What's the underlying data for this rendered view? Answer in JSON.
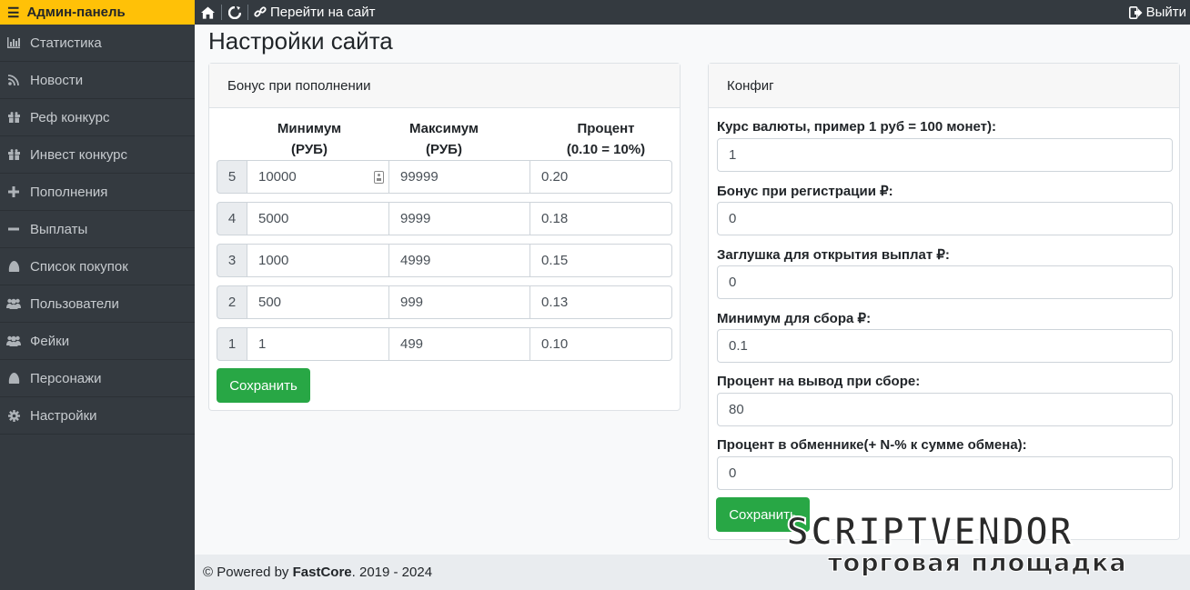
{
  "sidebar": {
    "title": "Админ-панель",
    "items": [
      {
        "label": "Статистика",
        "icon": "bar-chart-icon"
      },
      {
        "label": "Новости",
        "icon": "rss-icon"
      },
      {
        "label": "Реф конкурс",
        "icon": "gift-icon"
      },
      {
        "label": "Инвест конкурс",
        "icon": "gift-icon"
      },
      {
        "label": "Пополнения",
        "icon": "plus-icon"
      },
      {
        "label": "Выплаты",
        "icon": "minus-icon"
      },
      {
        "label": "Список покупок",
        "icon": "egg-icon"
      },
      {
        "label": "Пользователи",
        "icon": "users-icon"
      },
      {
        "label": "Фейки",
        "icon": "users-icon"
      },
      {
        "label": "Персонажи",
        "icon": "egg-icon"
      },
      {
        "label": "Настройки",
        "icon": "gear-icon"
      }
    ]
  },
  "topbar": {
    "goto_site": "Перейти на сайт",
    "logout": "Выйти"
  },
  "page": {
    "title": "Настройки сайта"
  },
  "bonus": {
    "header": "Бонус при пополнении",
    "col_min_1": "Минимум",
    "col_min_2": "(РУБ)",
    "col_max_1": "Максимум",
    "col_max_2": "(РУБ)",
    "col_pct_1": "Процент",
    "col_pct_2": "(0.10 = 10%)",
    "rows": [
      {
        "num": "5",
        "min": "10000",
        "max": "99999",
        "pct": "0.20"
      },
      {
        "num": "4",
        "min": "5000",
        "max": "9999",
        "pct": "0.18"
      },
      {
        "num": "3",
        "min": "1000",
        "max": "4999",
        "pct": "0.15"
      },
      {
        "num": "2",
        "min": "500",
        "max": "999",
        "pct": "0.13"
      },
      {
        "num": "1",
        "min": "1",
        "max": "499",
        "pct": "0.10"
      }
    ],
    "save": "Сохранить"
  },
  "config": {
    "header": "Конфиг",
    "fields": [
      {
        "label": "Курс валюты, пример 1 руб = 100 монет):",
        "value": "1"
      },
      {
        "label": "Бонус при регистрации ₽:",
        "value": "0"
      },
      {
        "label": "Заглушка для открытия выплат ₽:",
        "value": "0"
      },
      {
        "label": "Минимум для сбора ₽:",
        "value": "0.1"
      },
      {
        "label": "Процент на вывод при сборе:",
        "value": "80"
      },
      {
        "label": "Процент в обменнике(+ N-% к сумме обмена):",
        "value": "0"
      }
    ],
    "save": "Сохранить"
  },
  "footer": {
    "prefix": "© Powered by",
    "brand": "FastCore",
    "years": ". 2019 - 2024"
  },
  "watermark": {
    "line1": "SCRIPTVENDOR",
    "line2": "торговая площадка"
  }
}
